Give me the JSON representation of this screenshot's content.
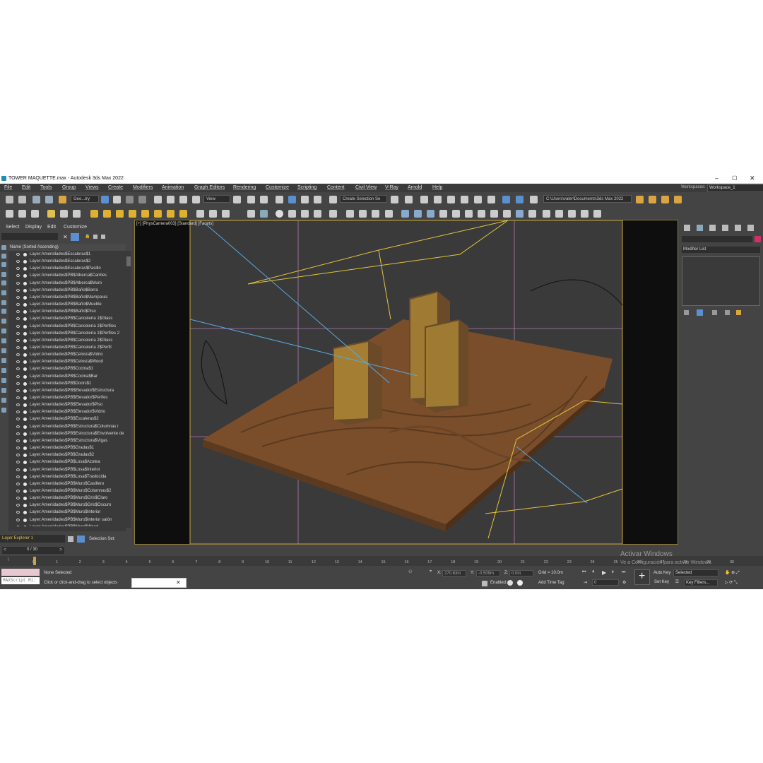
{
  "window": {
    "title": "TOWER MAQUETTE.max - Autodesk 3ds Max 2022"
  },
  "menu": [
    "File",
    "Edit",
    "Tools",
    "Group",
    "Views",
    "Create",
    "Modifiers",
    "Animation",
    "Graph Editors",
    "Rendering",
    "Customize",
    "Scripting",
    "Content",
    "Civil View",
    "V-Ray",
    "Arnold",
    "Help"
  ],
  "workspace": {
    "label": "Workspaces:",
    "value": "Workspace_1"
  },
  "toolbar": {
    "selection_filter": "Geo...try",
    "ref_coord": "View",
    "named_selection": "Create Selection Se",
    "project_path": "C:\\Users\\valer\\Documents\\3ds Max 2022"
  },
  "scene_explorer": {
    "tabs": [
      "Select",
      "Display",
      "Edit",
      "Customize"
    ],
    "column_header": "Name (Sorted Ascending)",
    "layers": [
      "Layer:Amenidades$Escaleras$1",
      "Layer:Amenidades$Escaleras$2",
      "Layer:Amenidades$Escaleras$Pasillo",
      "Layer:Amenidades$PB$Alberca$Carriles",
      "Layer:Amenidades$PB$Alberca$Muro",
      "Layer:Amenidades$PB$Baño$Barra",
      "Layer:Amenidades$PB$Baño$Mamparas",
      "Layer:Amenidades$PB$Baño$Mueble",
      "Layer:Amenidades$PB$Baño$Piso",
      "Layer:Amenidades$PB$Cancelería 1$Glass",
      "Layer:Amenidades$PB$Cancelería 1$Perfiles",
      "Layer:Amenidades$PB$Cancelería 1$Perfiles 2",
      "Layer:Amenidades$PB$Cancelería 2$Glass",
      "Layer:Amenidades$PB$Cancelería 2$Perfil",
      "Layer:Amenidades$PB$Celosía$Vidrio",
      "Layer:Amenidades$PB$Celosía$Wood",
      "Layer:Amenidades$PB$Cocina$1",
      "Layer:Amenidades$PB$Cocina$Bar",
      "Layer:Amenidades$PB$Doors$1",
      "Layer:Amenidades$PB$Elevador$Estructura",
      "Layer:Amenidades$PB$Elevador$Perifes",
      "Layer:Amenidades$PB$Elevador$Piso",
      "Layer:Amenidades$PB$Elevador$Vidrio",
      "Layer:Amenidades$PB$Escaleras$2",
      "Layer:Amenidades$PB$Estructura$Columnas i",
      "Layer:Amenidades$PB$Estructura$Envolvente de",
      "Layer:Amenidades$PB$Estructura$Vigas",
      "Layer:Amenidades$PB$Gradas$1",
      "Layer:Amenidades$PB$Gradas$2",
      "Layer:Amenidades$PB$Losa$Azotea",
      "Layer:Amenidades$PB$Losa$Interior",
      "Layer:Amenidades$PB$Losa$Traslúcida",
      "Layer:Amenidades$PB$Muro$Casillero",
      "Layer:Amenidades$PB$Muro$Columnas$2",
      "Layer:Amenidades$PB$Muro$Gris$Claro",
      "Layer:Amenidades$PB$Muro$Gris$Oscuro",
      "Layer:Amenidades$PB$Muro$Interior",
      "Layer:Amenidades$PB$Muro$Interior salón",
      "Layer:Amenidades$PB$Muro$Wood"
    ],
    "footer_name": "Layer Explorer 1",
    "selection_set_label": "Selection Set:"
  },
  "viewport": {
    "label": "[+] [PhysCamera003] [Standard] [Facets]"
  },
  "command_panel": {
    "modifier_list": "Modifier List"
  },
  "timeline": {
    "frame": "0 / 30",
    "ticks": [
      "0",
      "1",
      "2",
      "3",
      "4",
      "5",
      "6",
      "7",
      "8",
      "9",
      "10",
      "11",
      "12",
      "13",
      "14",
      "15",
      "16",
      "17",
      "18",
      "19",
      "20",
      "21",
      "22",
      "23",
      "24",
      "25",
      "26",
      "27",
      "28",
      "29",
      "30"
    ]
  },
  "status": {
    "maxscript": "MAXScript Mi:",
    "selection": "None Selected",
    "prompt": "Click or click-and-drag to select objects",
    "x_label": "X:",
    "x_value": "270.63m",
    "y_label": "Y:",
    "y_value": "-0.509m",
    "z_label": "Z:",
    "z_value": "0.0m",
    "grid": "Grid = 10.0m",
    "enabled": "Enabled:",
    "add_time_tag": "Add Time Tag",
    "auto_key": "Auto Key",
    "set_key": "Set Key",
    "selected": "Selected",
    "key_filters": "Key Filters...",
    "frame_field": "0",
    "watermark_1": "Activar Windows",
    "watermark_2": "Ve a Configuración para activar Windows."
  }
}
